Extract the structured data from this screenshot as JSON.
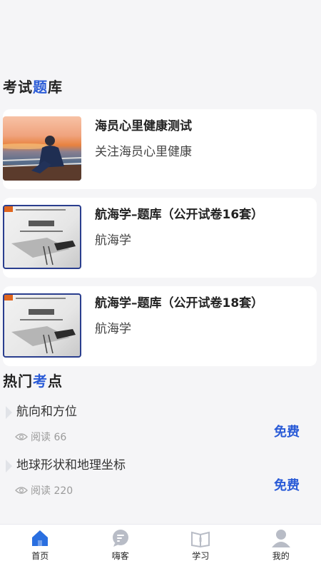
{
  "exam_section": {
    "title_prefix": "考试",
    "title_accent": "题",
    "title_suffix": "库",
    "cards": [
      {
        "title": "海员心里健康测试",
        "subtitle": "关注海员心里健康",
        "thumb_icon": "sunset-photo"
      },
      {
        "title": "航海学–题库（公开试卷16套）",
        "subtitle": "航海学",
        "thumb_icon": "book-cover"
      },
      {
        "title": "航海学–题库（公开试卷18套）",
        "subtitle": "航海学",
        "thumb_icon": "book-cover"
      }
    ]
  },
  "hot_section": {
    "title_prefix": "热门",
    "title_accent": "考",
    "title_suffix": "点",
    "items": [
      {
        "name": "航向和方位",
        "views": "阅读 66",
        "price": "免费"
      },
      {
        "name": "地球形状和地理坐标",
        "views": "阅读 220",
        "price": "免费"
      }
    ]
  },
  "tabbar": {
    "tabs": [
      {
        "label": "首页",
        "icon": "home-icon",
        "active": true
      },
      {
        "label": "嗨客",
        "icon": "chat-icon",
        "active": false
      },
      {
        "label": "学习",
        "icon": "book-icon",
        "active": false
      },
      {
        "label": "我的",
        "icon": "user-icon",
        "active": false
      }
    ]
  },
  "colors": {
    "accent": "#2a5bd7",
    "background": "#f5f5f7",
    "card": "#ffffff",
    "muted": "#9a9a9a"
  }
}
